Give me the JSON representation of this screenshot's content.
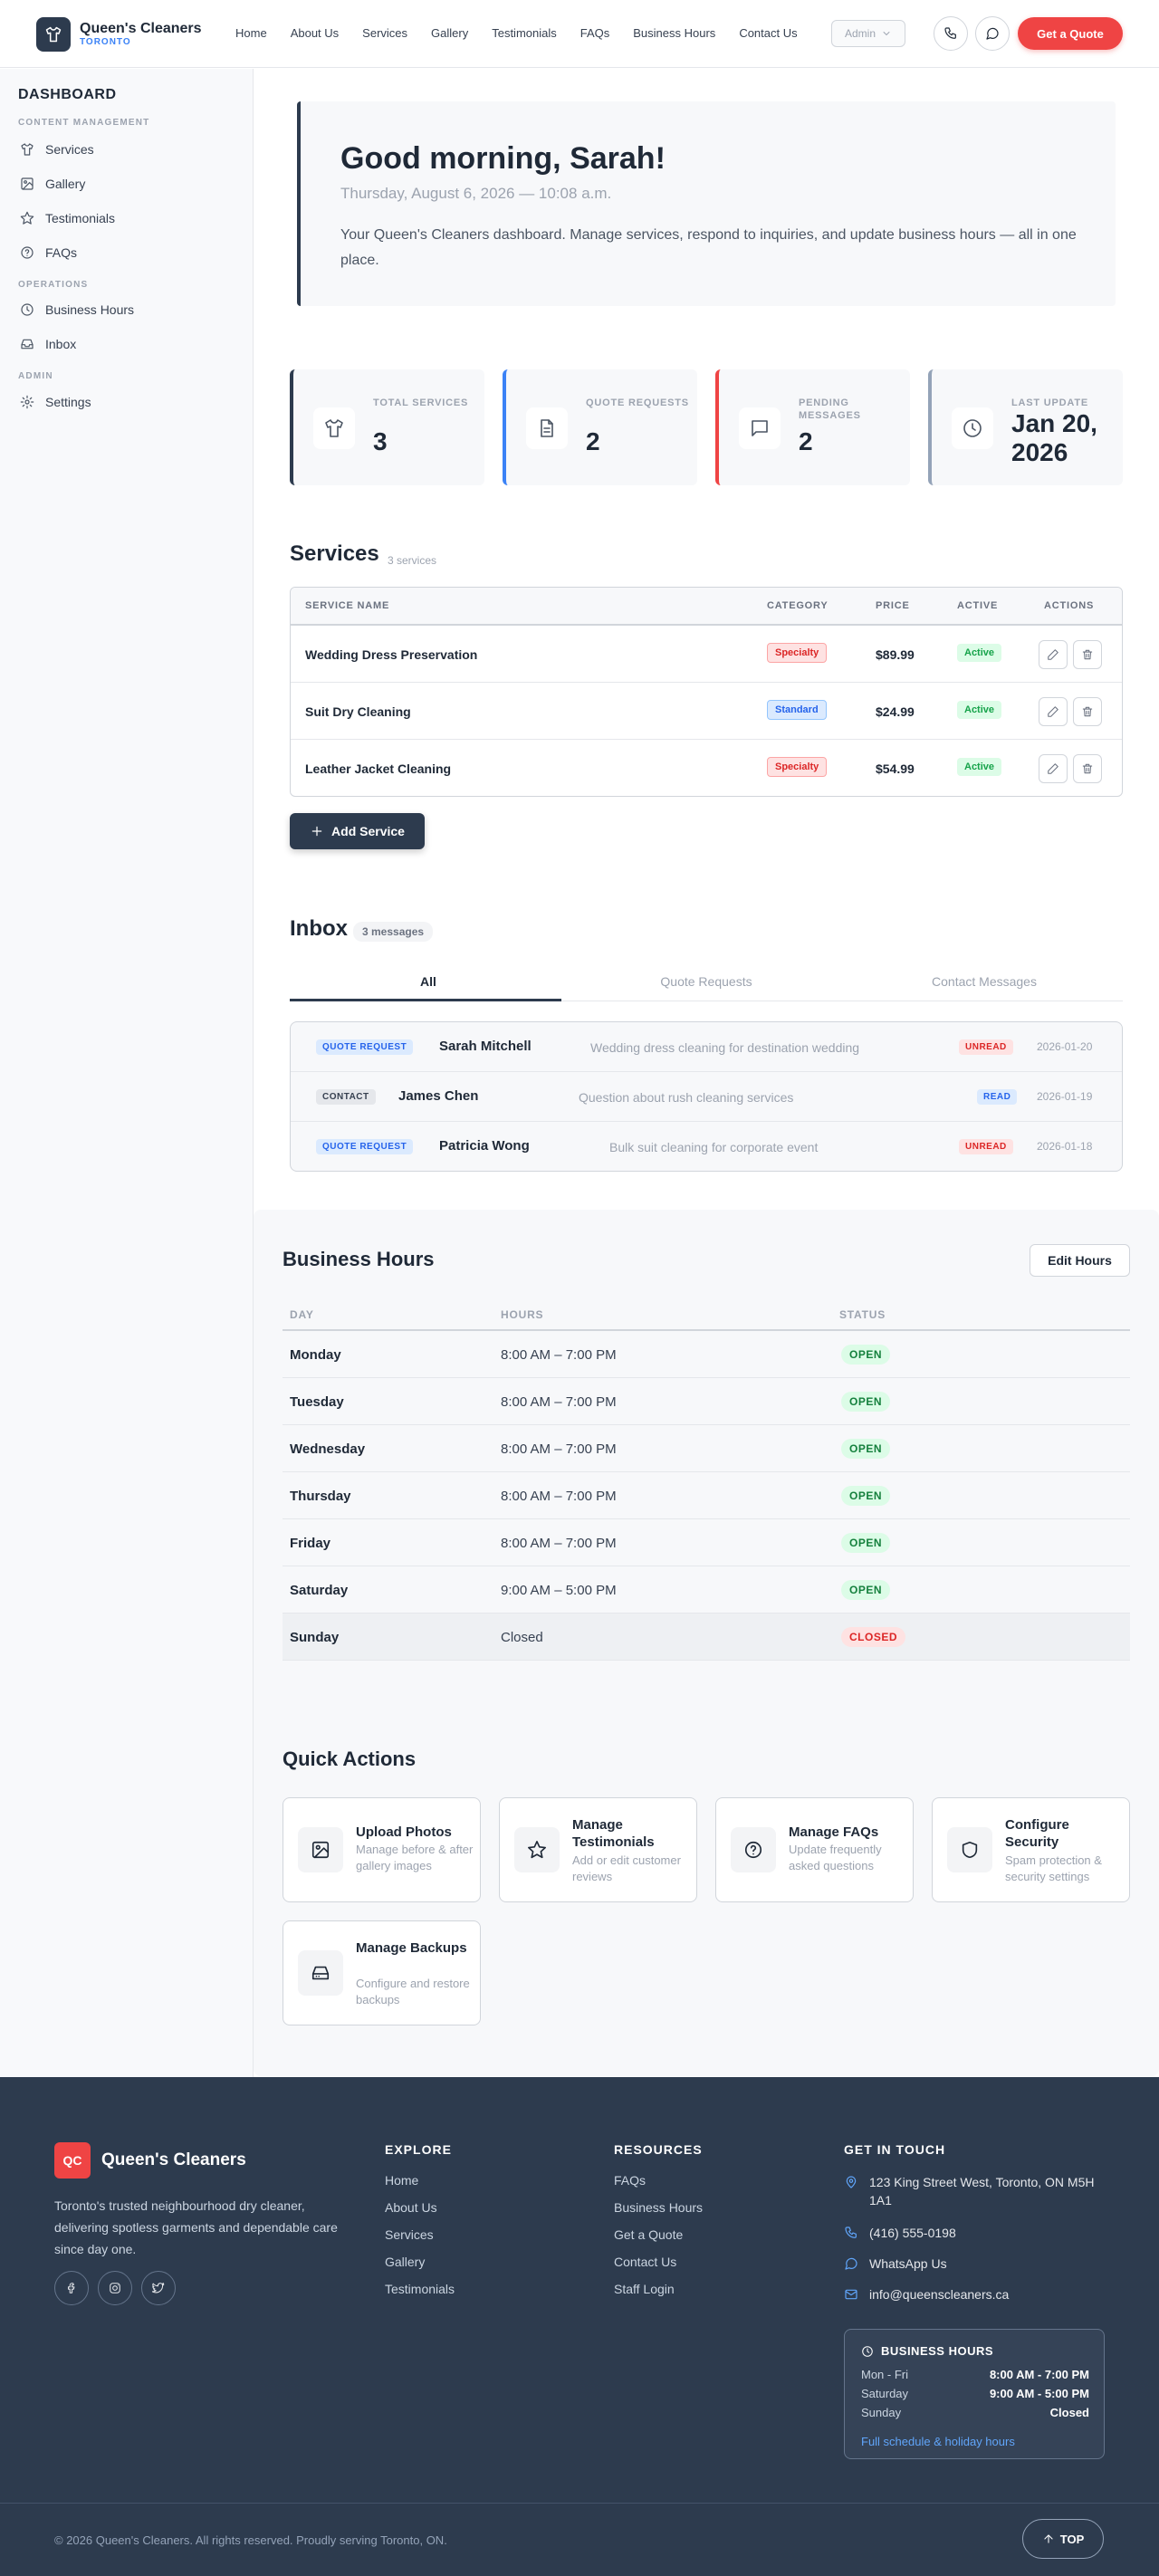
{
  "brand": {
    "name": "Queen's Cleaners",
    "city": "TORONTO",
    "initials": "QC"
  },
  "nav": [
    "Home",
    "About Us",
    "Services",
    "Gallery",
    "Testimonials",
    "FAQs",
    "Business Hours",
    "Contact Us"
  ],
  "header": {
    "admin_label": "Admin",
    "quote_label": "Get a Quote"
  },
  "sidebar": {
    "title": "DASHBOARD",
    "sections": [
      {
        "label": "CONTENT MANAGEMENT",
        "items": [
          {
            "label": "Services",
            "icon": "shirt-icon"
          },
          {
            "label": "Gallery",
            "icon": "image-icon"
          },
          {
            "label": "Testimonials",
            "icon": "star-icon"
          },
          {
            "label": "FAQs",
            "icon": "help-circle-icon"
          }
        ]
      },
      {
        "label": "OPERATIONS",
        "items": [
          {
            "label": "Business Hours",
            "icon": "clock-icon"
          },
          {
            "label": "Inbox",
            "icon": "inbox-icon"
          }
        ]
      },
      {
        "label": "ADMIN",
        "items": [
          {
            "label": "Settings",
            "icon": "gear-icon"
          }
        ]
      }
    ]
  },
  "greeting": {
    "title": "Good morning, Sarah!",
    "date": "Thursday, August 6, 2026 — 10:08 a.m.",
    "description": "Your Queen's Cleaners dashboard. Manage services, respond to inquiries, and update business hours — all in one place."
  },
  "stats": [
    {
      "label": "TOTAL SERVICES",
      "value": "3",
      "icon": "shirt-icon",
      "color": "#2d3b4e"
    },
    {
      "label": "QUOTE REQUESTS",
      "value": "2",
      "icon": "document-icon",
      "color": "#3b82f6"
    },
    {
      "label": "PENDING MESSAGES",
      "value": "2",
      "icon": "message-icon",
      "color": "#ef4444"
    },
    {
      "label": "LAST UPDATE",
      "value": "Jan 20, 2026",
      "icon": "clock-icon",
      "color": "#94a3b8"
    }
  ],
  "services": {
    "title": "Services",
    "count": "3 services",
    "columns": [
      "SERVICE NAME",
      "CATEGORY",
      "PRICE",
      "ACTIVE",
      "ACTIONS"
    ],
    "rows": [
      {
        "name": "Wedding Dress Preservation",
        "category": "Specialty",
        "price": "$89.99",
        "active": "Active"
      },
      {
        "name": "Suit Dry Cleaning",
        "category": "Standard",
        "price": "$24.99",
        "active": "Active"
      },
      {
        "name": "Leather Jacket Cleaning",
        "category": "Specialty",
        "price": "$54.99",
        "active": "Active"
      }
    ],
    "add_label": "Add Service"
  },
  "inbox": {
    "title": "Inbox",
    "count": "3 messages",
    "tabs": [
      "All",
      "Quote Requests",
      "Contact Messages"
    ],
    "messages": [
      {
        "type": "QUOTE REQUEST",
        "name": "Sarah Mitchell",
        "subject": "Wedding dress cleaning for destination wedding",
        "status": "UNREAD",
        "date": "2026-01-20"
      },
      {
        "type": "CONTACT",
        "name": "James Chen",
        "subject": "Question about rush cleaning services",
        "status": "READ",
        "date": "2026-01-19"
      },
      {
        "type": "QUOTE REQUEST",
        "name": "Patricia Wong",
        "subject": "Bulk suit cleaning for corporate event",
        "status": "UNREAD",
        "date": "2026-01-18"
      }
    ]
  },
  "hours": {
    "title": "Business Hours",
    "edit_label": "Edit Hours",
    "columns": [
      "DAY",
      "HOURS",
      "STATUS"
    ],
    "rows": [
      {
        "day": "Monday",
        "hours": "8:00 AM – 7:00 PM",
        "status": "OPEN"
      },
      {
        "day": "Tuesday",
        "hours": "8:00 AM – 7:00 PM",
        "status": "OPEN"
      },
      {
        "day": "Wednesday",
        "hours": "8:00 AM – 7:00 PM",
        "status": "OPEN"
      },
      {
        "day": "Thursday",
        "hours": "8:00 AM – 7:00 PM",
        "status": "OPEN"
      },
      {
        "day": "Friday",
        "hours": "8:00 AM – 7:00 PM",
        "status": "OPEN"
      },
      {
        "day": "Saturday",
        "hours": "9:00 AM – 5:00 PM",
        "status": "OPEN"
      },
      {
        "day": "Sunday",
        "hours": "Closed",
        "status": "CLOSED"
      }
    ]
  },
  "quick_actions": {
    "title": "Quick Actions",
    "items": [
      {
        "title": "Upload Photos",
        "desc": "Manage before & after gallery images",
        "icon": "image-icon"
      },
      {
        "title": "Manage Testimonials",
        "desc": "Add or edit customer reviews",
        "icon": "star-icon"
      },
      {
        "title": "Manage FAQs",
        "desc": "Update frequently asked questions",
        "icon": "help-circle-icon"
      },
      {
        "title": "Configure Security",
        "desc": "Spam protection & security settings",
        "icon": "shield-icon"
      },
      {
        "title": "Manage Backups",
        "desc": "Configure and restore backups",
        "icon": "hard-drive-icon"
      }
    ]
  },
  "footer": {
    "description": "Toronto's trusted neighbourhood dry cleaner, delivering spotless garments and dependable care since day one.",
    "explore_title": "EXPLORE",
    "explore": [
      "Home",
      "About Us",
      "Services",
      "Gallery",
      "Testimonials"
    ],
    "resources_title": "RESOURCES",
    "resources": [
      "FAQs",
      "Business Hours",
      "Get a Quote",
      "Contact Us",
      "Staff Login"
    ],
    "contact_title": "GET IN TOUCH",
    "address": "123 King Street West, Toronto, ON M5H 1A1",
    "phone": "(416) 555-0198",
    "whatsapp": "WhatsApp Us",
    "email": "info@queenscleaners.ca",
    "hours_title": "BUSINESS HOURS",
    "hours": [
      {
        "label": "Mon - Fri",
        "value": "8:00 AM - 7:00 PM"
      },
      {
        "label": "Saturday",
        "value": "9:00 AM - 5:00 PM"
      },
      {
        "label": "Sunday",
        "value": "Closed"
      }
    ],
    "hours_link": "Full schedule & holiday hours",
    "copyright": "© 2026 Queen's Cleaners. All rights reserved. Proudly serving Toronto, ON.",
    "top_label": "TOP"
  }
}
